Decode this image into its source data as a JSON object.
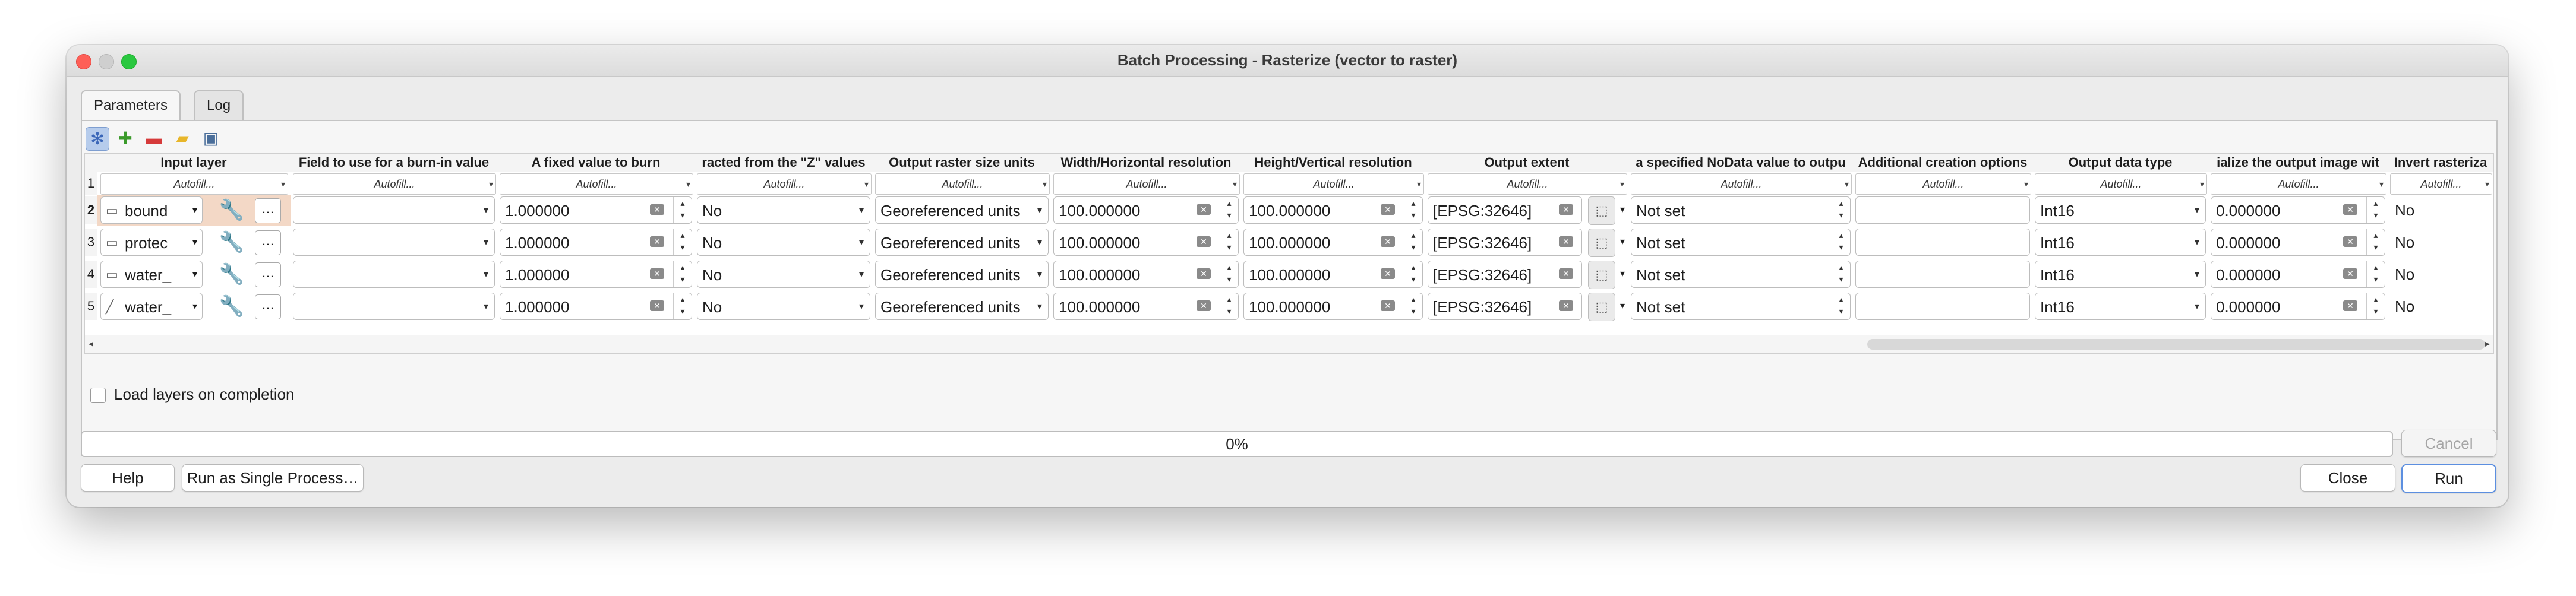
{
  "window": {
    "title": "Batch Processing - Rasterize (vector to raster)"
  },
  "tabs": [
    "Parameters",
    "Log"
  ],
  "toolbar": {
    "icons": [
      "options-icon",
      "add-row-icon",
      "remove-row-icon",
      "open-folder-icon",
      "save-icon"
    ]
  },
  "table": {
    "columns": [
      "Input layer",
      "Field to use for a burn-in value",
      "A fixed value to burn",
      "racted from the \"Z\" values",
      "Output raster size units",
      "Width/Horizontal resolution",
      "Height/Vertical resolution",
      "Output extent",
      "a specified NoData value to outpu",
      "Additional creation options",
      "Output data type",
      "ialize the output image wit",
      "Invert rasteriza"
    ],
    "autofill_label": "Autofill...",
    "autofill_row_number": "1",
    "rows": [
      {
        "num": "2",
        "layer": "bound",
        "layer_icon": "polygon-layer-icon",
        "field": "",
        "burn": "1.000000",
        "z": "No",
        "units": "Georeferenced units",
        "width": "100.000000",
        "height": "100.000000",
        "extent": "[EPSG:32646]",
        "nodata": "Not set",
        "options": "",
        "dtype": "Int16",
        "init": "0.000000",
        "invert": "No"
      },
      {
        "num": "3",
        "layer": "protec",
        "layer_icon": "polygon-layer-icon",
        "field": "",
        "burn": "1.000000",
        "z": "No",
        "units": "Georeferenced units",
        "width": "100.000000",
        "height": "100.000000",
        "extent": "[EPSG:32646]",
        "nodata": "Not set",
        "options": "",
        "dtype": "Int16",
        "init": "0.000000",
        "invert": "No"
      },
      {
        "num": "4",
        "layer": "water_",
        "layer_icon": "polygon-layer-icon",
        "field": "",
        "burn": "1.000000",
        "z": "No",
        "units": "Georeferenced units",
        "width": "100.000000",
        "height": "100.000000",
        "extent": "[EPSG:32646]",
        "nodata": "Not set",
        "options": "",
        "dtype": "Int16",
        "init": "0.000000",
        "invert": "No"
      },
      {
        "num": "5",
        "layer": "water_",
        "layer_icon": "line-layer-icon",
        "field": "",
        "burn": "1.000000",
        "z": "No",
        "units": "Georeferenced units",
        "width": "100.000000",
        "height": "100.000000",
        "extent": "[EPSG:32646]",
        "nodata": "Not set",
        "options": "",
        "dtype": "Int16",
        "init": "0.000000",
        "invert": "No"
      }
    ]
  },
  "load_layers_label": "Load layers on completion",
  "progress_text": "0%",
  "buttons": {
    "cancel": "Cancel",
    "help": "Help",
    "single": "Run as Single Process…",
    "close": "Close",
    "run": "Run"
  }
}
